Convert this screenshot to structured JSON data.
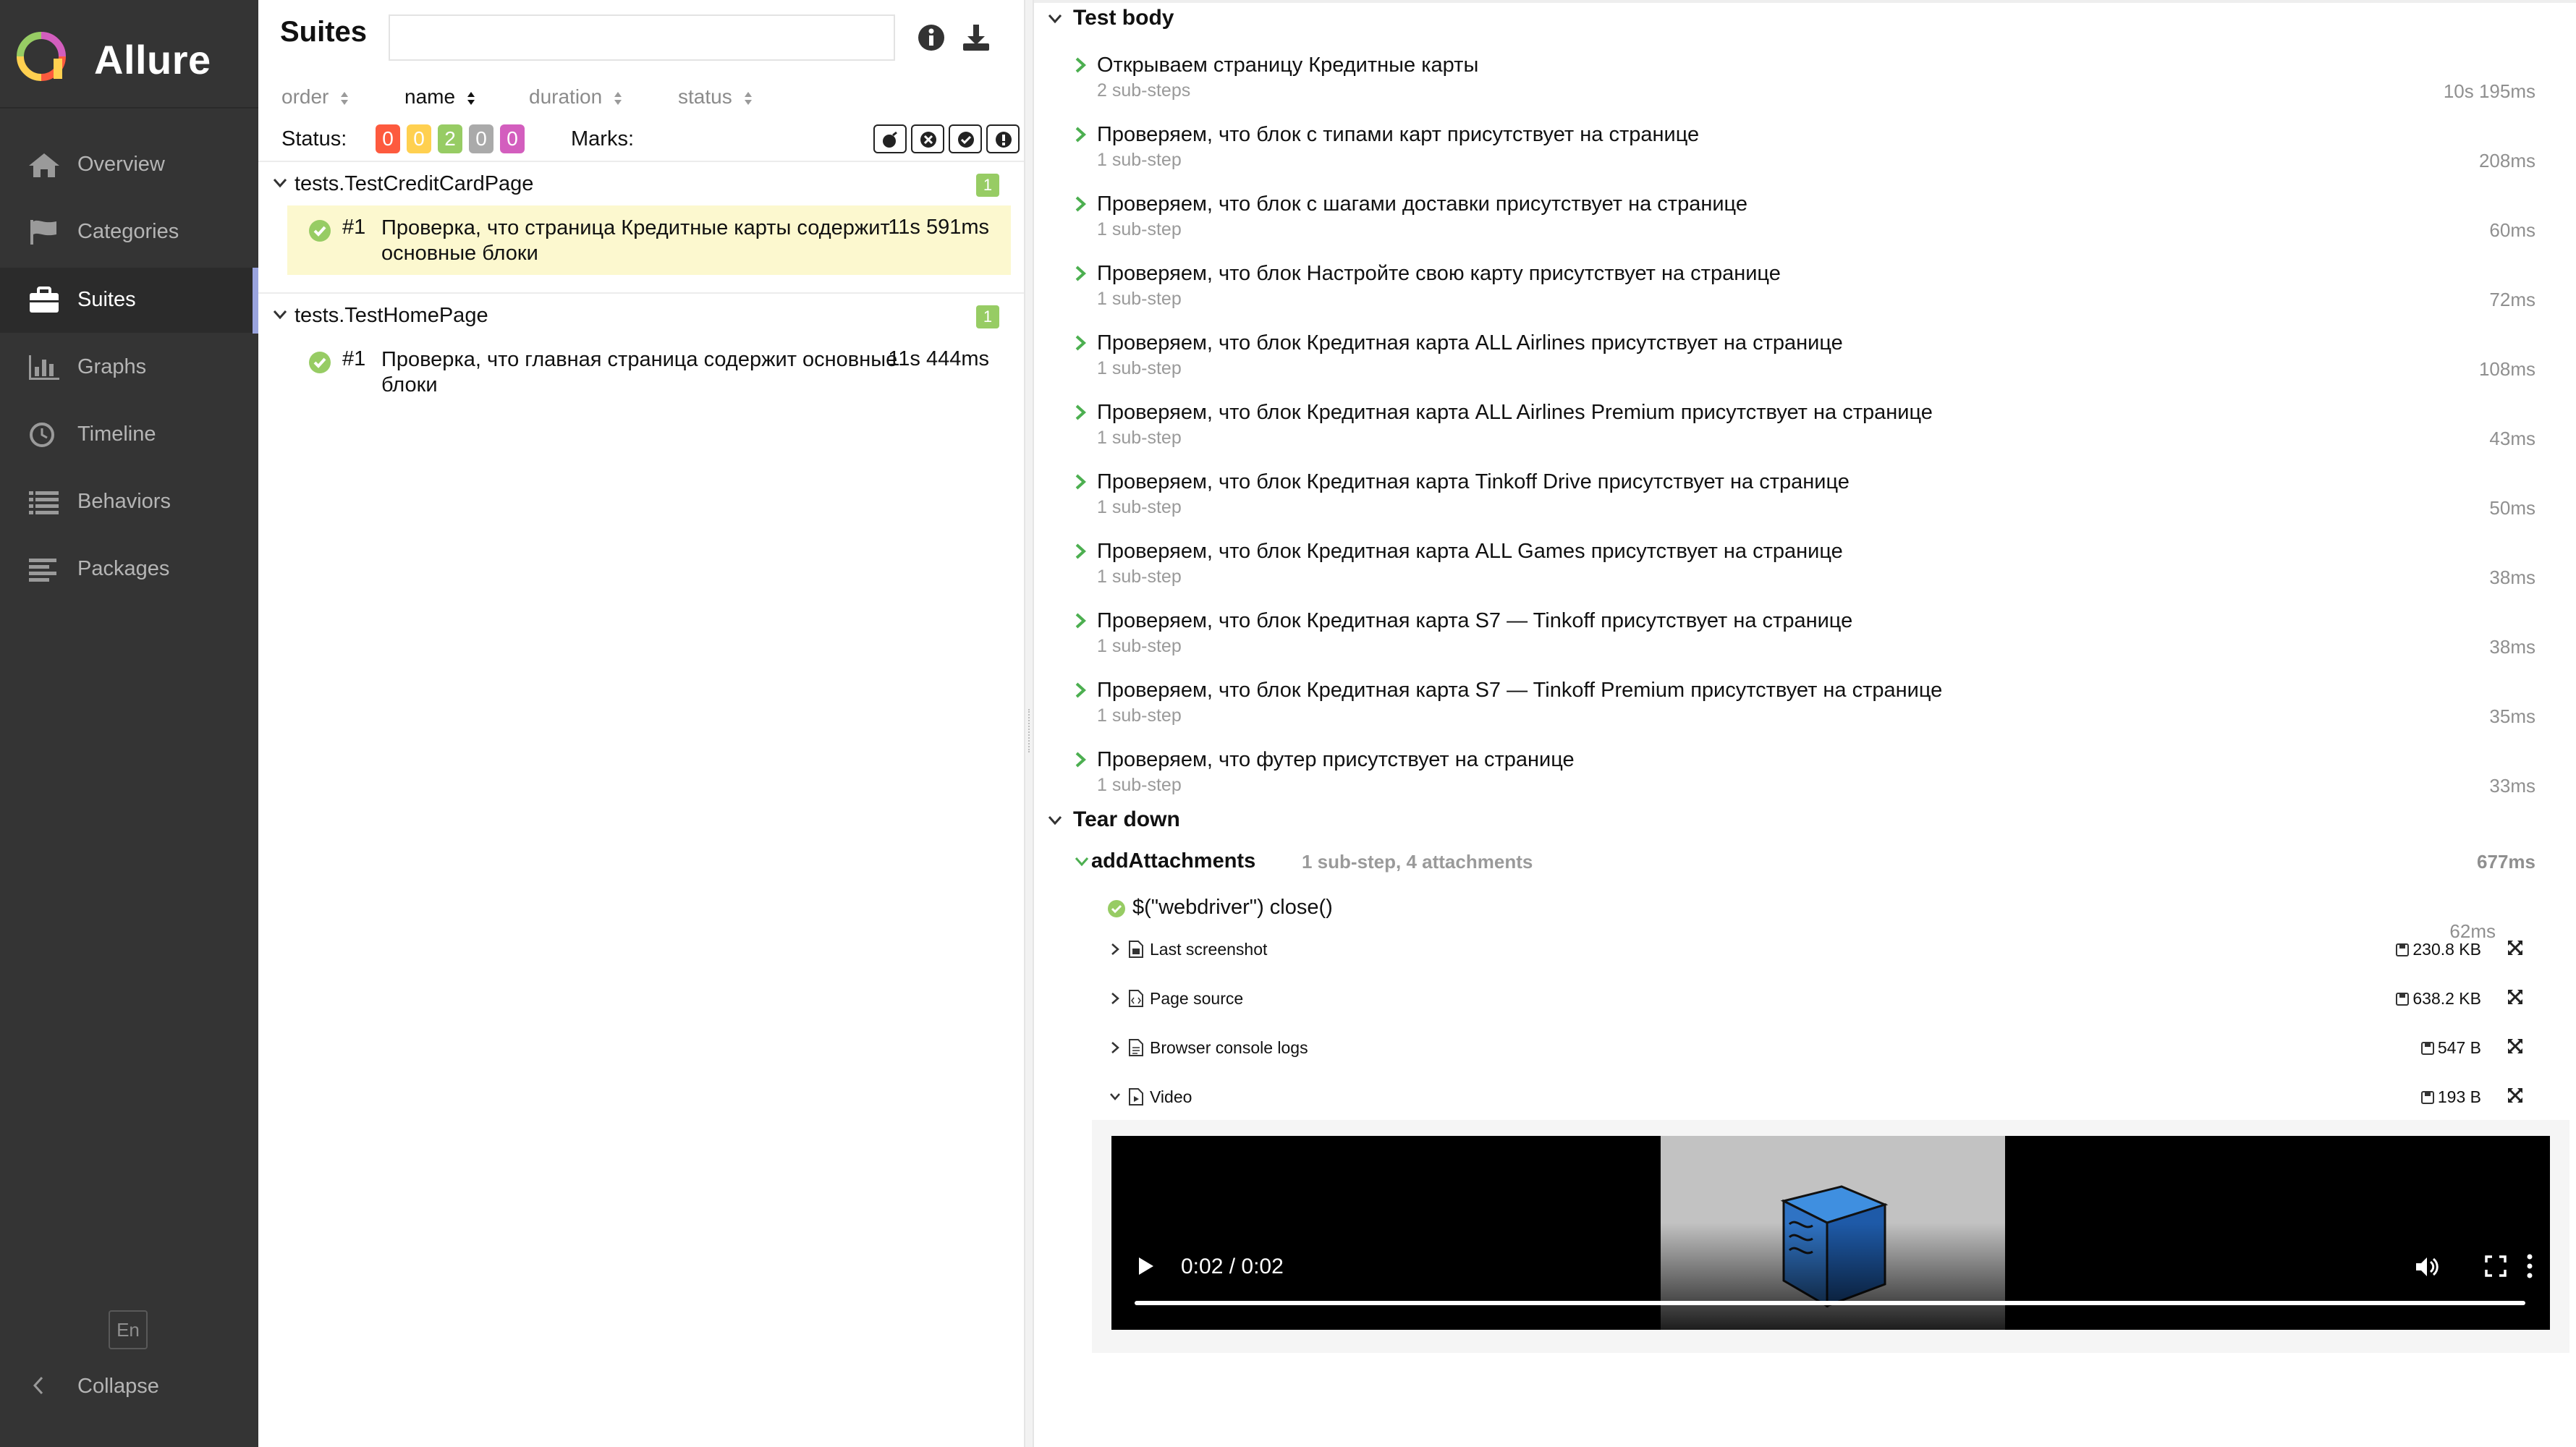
{
  "sidebar": {
    "brand": "Allure",
    "items": [
      {
        "label": "Overview",
        "icon": "home-icon"
      },
      {
        "label": "Categories",
        "icon": "flag-icon"
      },
      {
        "label": "Suites",
        "icon": "briefcase-icon"
      },
      {
        "label": "Graphs",
        "icon": "bar-chart-icon"
      },
      {
        "label": "Timeline",
        "icon": "clock-icon"
      },
      {
        "label": "Behaviors",
        "icon": "list-icon"
      },
      {
        "label": "Packages",
        "icon": "align-left-icon"
      }
    ],
    "language": "En",
    "collapse_label": "Collapse"
  },
  "suites": {
    "title": "Suites",
    "search_placeholder": "",
    "sort": {
      "order": "order",
      "name": "name",
      "duration": "duration",
      "status": "status"
    },
    "status_label": "Status:",
    "status_counts": [
      {
        "value": "0",
        "color": "#fd5a3e"
      },
      {
        "value": "0",
        "color": "#ffd050"
      },
      {
        "value": "2",
        "color": "#97cc64"
      },
      {
        "value": "0",
        "color": "#aaaaaa"
      },
      {
        "value": "0",
        "color": "#d35ebe"
      }
    ],
    "marks_label": "Marks:",
    "groups": [
      {
        "name": "tests.TestCreditCardPage",
        "count": "1",
        "tests": [
          {
            "num": "#1",
            "name": "Проверка, что страница Кредитные карты содержит основные блоки",
            "duration": "11s 591ms"
          }
        ]
      },
      {
        "name": "tests.TestHomePage",
        "count": "1",
        "tests": [
          {
            "num": "#1",
            "name": "Проверка, что главная страница содержит основные блоки",
            "duration": "11s 444ms"
          }
        ]
      }
    ]
  },
  "detail": {
    "test_body_label": "Test body",
    "steps": [
      {
        "name": "Открываем страницу Кредитные карты",
        "sub": "2 sub-steps",
        "duration": "10s 195ms"
      },
      {
        "name": "Проверяем, что блок с типами карт присутствует на странице",
        "sub": "1 sub-step",
        "duration": "208ms"
      },
      {
        "name": "Проверяем, что блок с шагами доставки присутствует на странице",
        "sub": "1 sub-step",
        "duration": "60ms"
      },
      {
        "name": "Проверяем, что блок Настройте свою карту присутствует на странице",
        "sub": "1 sub-step",
        "duration": "72ms"
      },
      {
        "name": "Проверяем, что блок Кредитная карта ALL Airlines присутствует на странице",
        "sub": "1 sub-step",
        "duration": "108ms"
      },
      {
        "name": "Проверяем, что блок Кредитная карта ALL Airlines Premium присутствует на странице",
        "sub": "1 sub-step",
        "duration": "43ms"
      },
      {
        "name": "Проверяем, что блок Кредитная карта Tinkoff Drive присутствует на странице",
        "sub": "1 sub-step",
        "duration": "50ms"
      },
      {
        "name": "Проверяем, что блок Кредитная карта ALL Games присутствует на странице",
        "sub": "1 sub-step",
        "duration": "38ms"
      },
      {
        "name": "Проверяем, что блок Кредитная карта S7 — Tinkoff присутствует на странице",
        "sub": "1 sub-step",
        "duration": "38ms"
      },
      {
        "name": "Проверяем, что блок Кредитная карта S7 — Tinkoff Premium присутствует на странице",
        "sub": "1 sub-step",
        "duration": "35ms"
      },
      {
        "name": "Проверяем, что футер присутствует на странице",
        "sub": "1 sub-step",
        "duration": "33ms"
      }
    ],
    "tear_down_label": "Tear down",
    "teardown_step": {
      "name": "addAttachments",
      "meta": "1 sub-step, 4 attachments",
      "duration": "677ms"
    },
    "inner_step": {
      "name": "$(\"webdriver\") close()",
      "duration": "62ms"
    },
    "attachments": [
      {
        "name": "Last screenshot",
        "size": "230.8 KB"
      },
      {
        "name": "Page source",
        "size": "638.2 KB"
      },
      {
        "name": "Browser console logs",
        "size": "547 B"
      },
      {
        "name": "Video",
        "size": "193 B"
      }
    ],
    "video": {
      "time": "0:02 / 0:02",
      "progress": 1.0
    }
  }
}
